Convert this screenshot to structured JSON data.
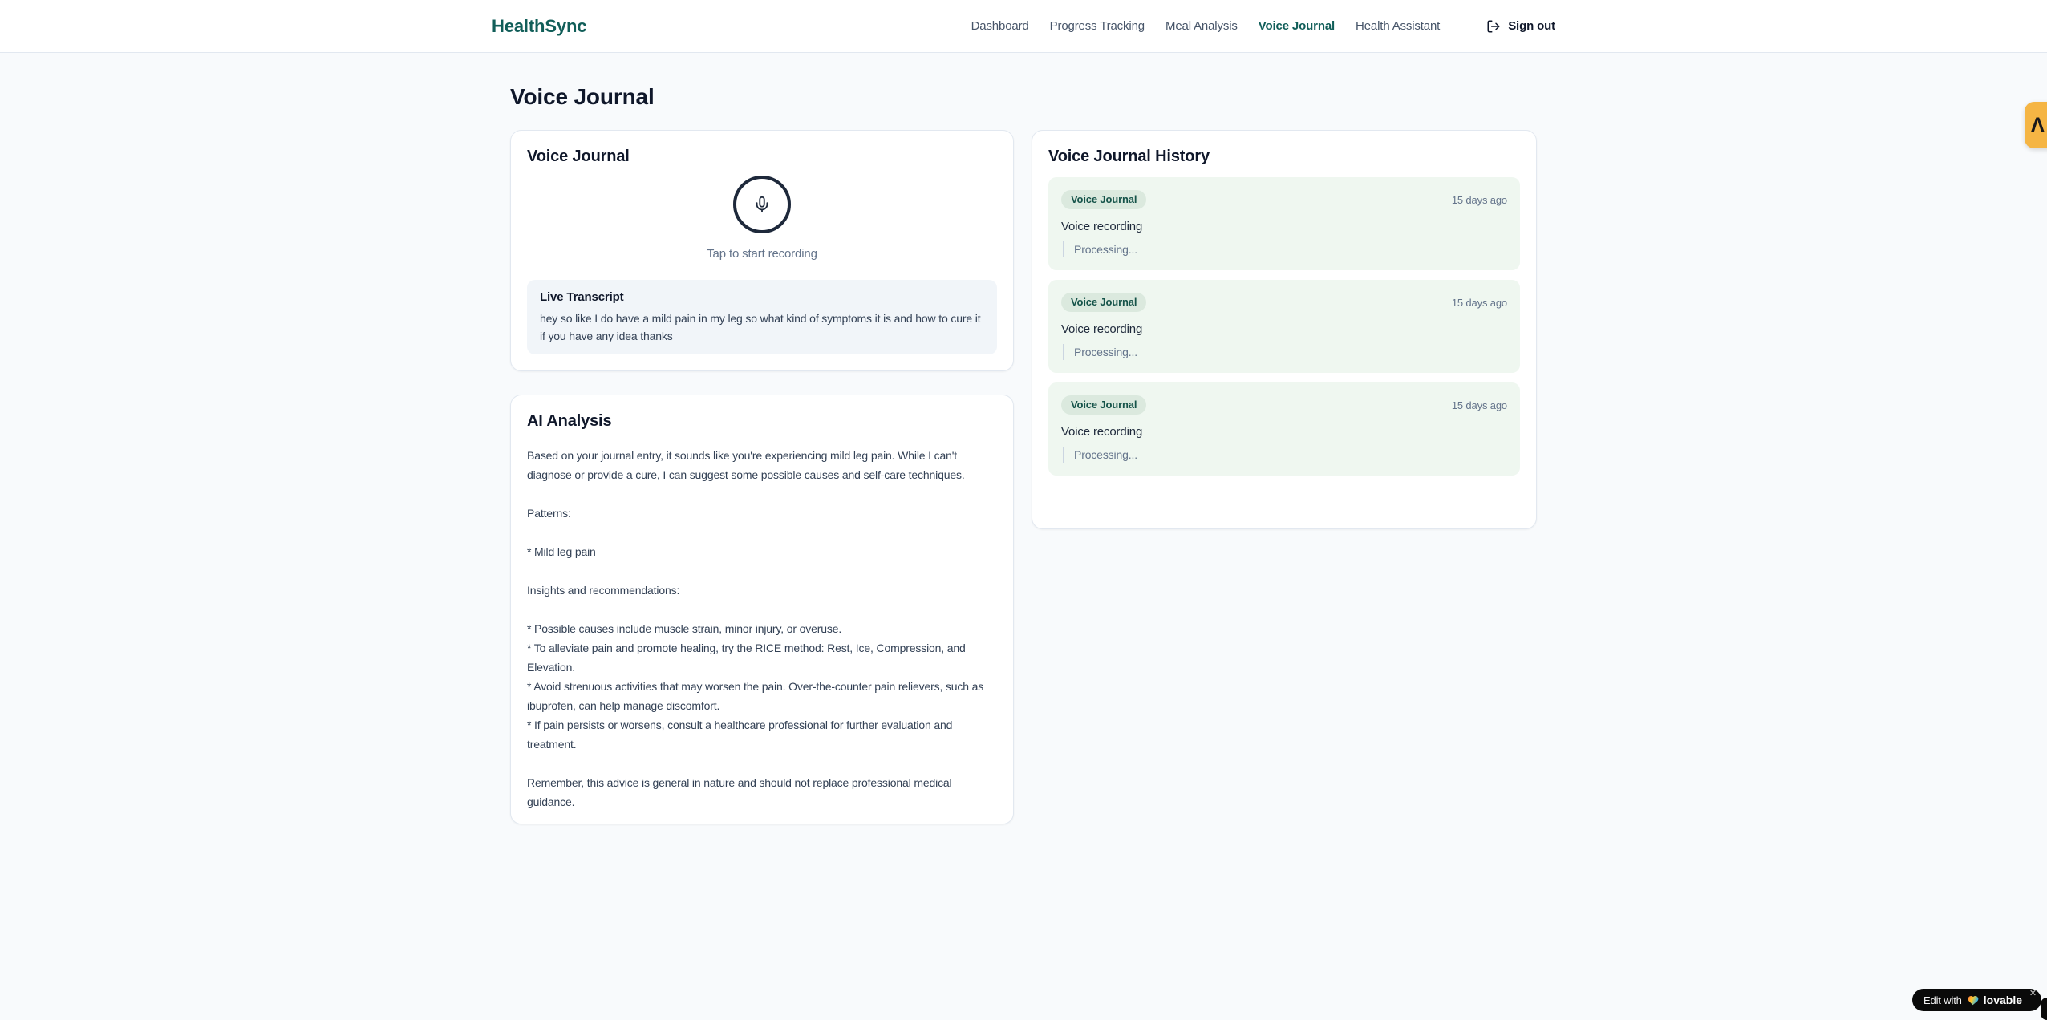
{
  "header": {
    "logo": "HealthSync",
    "nav": [
      {
        "label": "Dashboard"
      },
      {
        "label": "Progress Tracking"
      },
      {
        "label": "Meal Analysis"
      },
      {
        "label": "Voice Journal"
      },
      {
        "label": "Health Assistant"
      }
    ],
    "active_nav": "Voice Journal",
    "sign_out_label": "Sign out"
  },
  "page": {
    "title": "Voice Journal"
  },
  "recorder": {
    "card_title": "Voice Journal",
    "mic_icon": "microphone-icon",
    "tap_hint": "Tap to start recording",
    "transcript_title": "Live Transcript",
    "transcript_text": "hey so like I do have a mild pain in my leg so what kind of symptoms it is and how to cure it if you have any idea thanks"
  },
  "analysis": {
    "card_title": "AI Analysis",
    "body": "Based on your journal entry, it sounds like you're experiencing mild leg pain. While I can't diagnose or provide a cure, I can suggest some possible causes and self-care techniques.\n\nPatterns:\n\n* Mild leg pain\n\nInsights and recommendations:\n\n* Possible causes include muscle strain, minor injury, or overuse.\n* To alleviate pain and promote healing, try the RICE method: Rest, Ice, Compression, and Elevation.\n* Avoid strenuous activities that may worsen the pain. Over-the-counter pain relievers, such as ibuprofen, can help manage discomfort.\n* If pain persists or worsens, consult a healthcare professional for further evaluation and treatment.\n\nRemember, this advice is general in nature and should not replace professional medical guidance."
  },
  "history": {
    "card_title": "Voice Journal History",
    "entries": [
      {
        "badge": "Voice Journal",
        "time": "15 days ago",
        "title": "Voice recording",
        "status": "Processing..."
      },
      {
        "badge": "Voice Journal",
        "time": "15 days ago",
        "title": "Voice recording",
        "status": "Processing..."
      },
      {
        "badge": "Voice Journal",
        "time": "15 days ago",
        "title": "Voice recording",
        "status": "Processing..."
      }
    ]
  },
  "overlays": {
    "extension_glyph": "Λ",
    "lovable": {
      "prefix": "Edit with",
      "brand": "lovable",
      "close": "✕"
    }
  },
  "colors": {
    "brand_teal": "#115e59",
    "page_bg": "#f8fafc",
    "entry_bg": "#eff7f0",
    "badge_bg": "#dbe9de",
    "amber_badge": "#f5b544",
    "mic_ring": "#1e293b"
  }
}
